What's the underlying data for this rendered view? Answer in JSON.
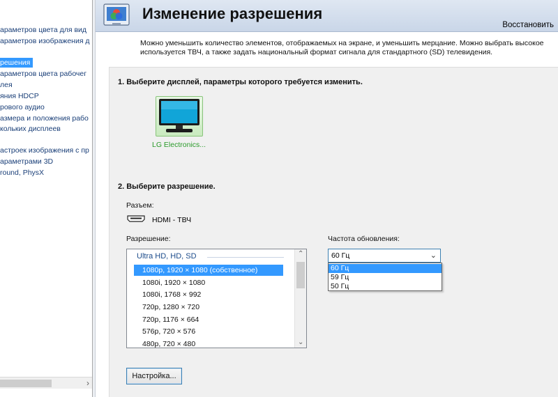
{
  "sidebar": {
    "items": [
      {
        "label": "араметров цвета для вид",
        "selected": false
      },
      {
        "label": "араметров изображения д",
        "selected": false
      },
      {
        "label": "решения",
        "selected": true
      },
      {
        "label": "араметров цвета рабочег",
        "selected": false
      },
      {
        "label": "лея",
        "selected": false
      },
      {
        "label": "яния HDCP",
        "selected": false
      },
      {
        "label": "рового аудио",
        "selected": false
      },
      {
        "label": "азмера и положения рабо",
        "selected": false
      },
      {
        "label": "кольких дисплеев",
        "selected": false
      },
      {
        "label": "астроек изображения с пр",
        "selected": false
      },
      {
        "label": "араметрами 3D",
        "selected": false
      },
      {
        "label": "round, PhysX",
        "selected": false
      }
    ],
    "scroll_right_icon": "chevron-right-icon"
  },
  "header": {
    "title": "Изменение разрешения",
    "restore_label": "Восстановить",
    "icon": "display-settings-icon"
  },
  "description": {
    "line1": "Можно уменьшить количество элементов, отображаемых на экране, и уменьшить мерцание. Можно выбрать высокое",
    "line2": "используется ТВЧ, а также задать национальный формат сигнала для стандартного (SD) телевидения."
  },
  "step1": {
    "title": "1. Выберите дисплей, параметры которого требуется изменить.",
    "display_label": "LG Electronics..."
  },
  "step2": {
    "title": "2. Выберите разрешение.",
    "connector_label": "Разъем:",
    "connector_value": "HDMI - ТВЧ",
    "resolution_label": "Разрешение:",
    "resolution_group": "Ultra HD, HD, SD",
    "resolutions": [
      "1080p, 1920 × 1080 (собственное)",
      "1080i, 1920 × 1080",
      "1080i, 1768 × 992",
      "720p, 1280 × 720",
      "720p, 1176 × 664",
      "576p, 720 × 576",
      "480p, 720 × 480"
    ],
    "selected_resolution_index": 0,
    "refresh_label": "Частота обновления:",
    "refresh_value": "60 Гц",
    "refresh_options": [
      "60 Гц",
      "59 Гц",
      "50 Гц"
    ],
    "selected_refresh_index": 0
  },
  "settings_button": "Настройка...",
  "colors": {
    "selection": "#3399ff",
    "header_gradient_top": "#dfe7f2",
    "display_label": "#2a9a2a"
  }
}
